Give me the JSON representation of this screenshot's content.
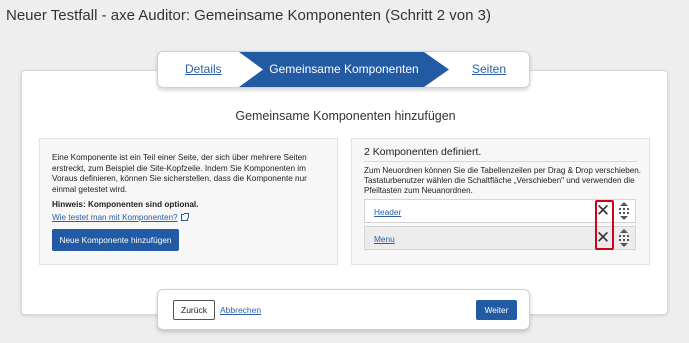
{
  "window": {
    "title": "Neuer Testfall - axe Auditor: Gemeinsame Komponenten (Schritt 2 von 3)"
  },
  "stepper": {
    "steps": [
      {
        "label": "Details",
        "state": "done"
      },
      {
        "label": "Gemeinsame Komponenten",
        "state": "active"
      },
      {
        "label": "Seiten",
        "state": "upcoming"
      }
    ]
  },
  "section": {
    "title": "Gemeinsame Komponenten hinzufügen"
  },
  "info": {
    "text": "Eine Komponente ist ein Teil einer Seite, der sich über mehrere Seiten erstreckt, zum Beispiel die Site-Kopfzeile. Indem Sie Komponenten im Voraus definieren, können Sie sicherstellen, dass die Komponente nur einmal getestet wird.",
    "hint": "Hinweis: Komponenten sind optional.",
    "link": "Wie testet man mit Komponenten?",
    "add_button": "Neue Komponente hinzufügen"
  },
  "components": {
    "count_text": "2 Komponenten definiert.",
    "description": "Zum Neuordnen können Sie die Tabellenzeilen per Drag & Drop verschieben. Tastaturbenutzer wählen die Schaltfläche „Verschieben\" und verwenden die Pfeiltasten zum Neuanordnen.",
    "items": [
      {
        "label": "Header"
      },
      {
        "label": "Menu"
      }
    ],
    "remove_glyph": "✕"
  },
  "footer": {
    "back": "Zurück",
    "cancel": "Abbrechen",
    "next": "Weiter"
  },
  "colors": {
    "primary": "#235aa4",
    "link": "#2a5ea8",
    "highlight": "#d0021b"
  },
  "icons": {
    "remove": "close-icon",
    "drag": "drag-handle-icon",
    "external": "external-link-icon"
  }
}
